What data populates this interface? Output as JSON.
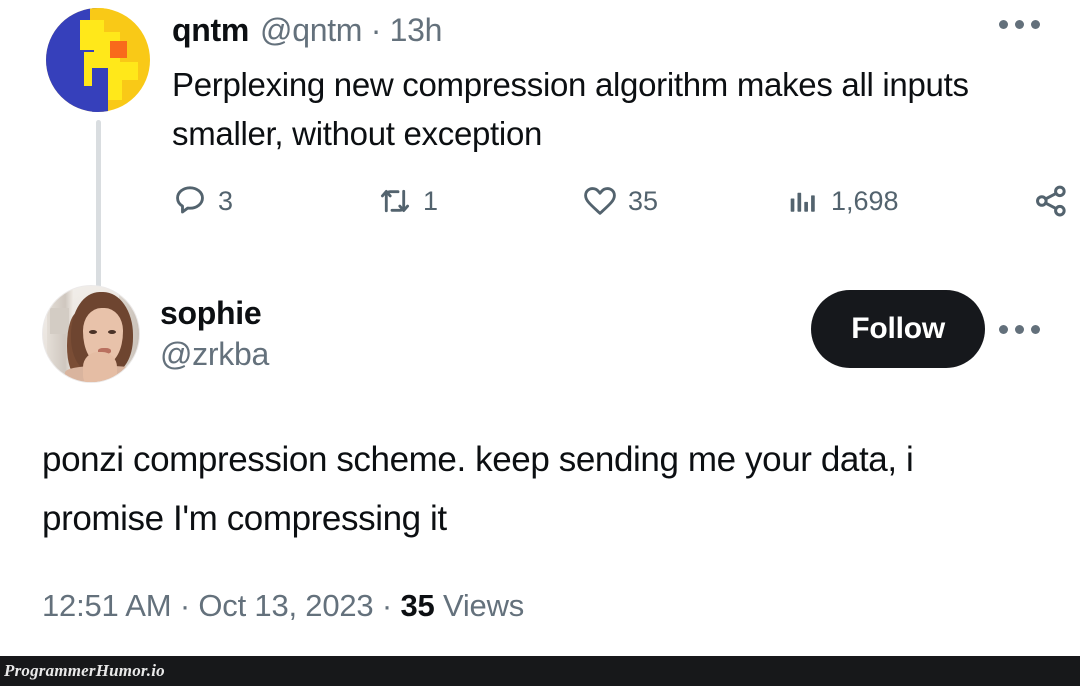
{
  "thread_tweet": {
    "avatar_name": "qntm-avatar",
    "display_name": "qntm",
    "handle_and_time": "@qntm · 13h",
    "text": "Perplexing new compression algorithm makes all inputs smaller, without exception",
    "actions": {
      "reply_count": "3",
      "retweet_count": "1",
      "like_count": "35",
      "views_count": "1,698",
      "share_label": ""
    },
    "more_menu_label": "More"
  },
  "reply_tweet": {
    "avatar_name": "sophie-avatar",
    "display_name": "sophie",
    "handle": "@zrkba",
    "follow_label": "Follow",
    "text": "ponzi compression scheme. keep sending me your data, i promise I'm compressing it",
    "meta": {
      "time": "12:51 AM",
      "separator_1": "·",
      "date": "Oct 13, 2023",
      "separator_2": "·",
      "views_count": "35",
      "views_label": "Views"
    }
  },
  "watermark": {
    "text": "ProgrammerHumor.io"
  },
  "colors": {
    "background": "#ffffff",
    "primary_text": "#0c0f12",
    "secondary_text": "#64717c",
    "action_icon": "#53636e",
    "follow_button_bg": "#16181c",
    "follow_button_text": "#ffffff",
    "thread_line": "#d9dde0",
    "watermark_bar": "#17181a"
  }
}
